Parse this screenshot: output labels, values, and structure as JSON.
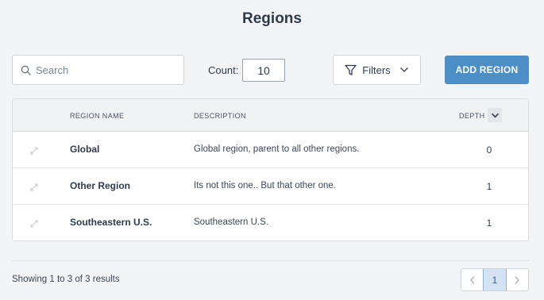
{
  "page": {
    "title": "Regions"
  },
  "toolbar": {
    "search_placeholder": "Search",
    "search_value": "",
    "count_label": "Count:",
    "count_value": "10",
    "filters_label": "Filters",
    "add_label": "ADD REGION"
  },
  "table": {
    "columns": [
      "REGION NAME",
      "DESCRIPTION",
      "DEPTH"
    ],
    "rows": [
      {
        "name": "Global",
        "description": "Global region, parent to all other regions.",
        "depth": "0"
      },
      {
        "name": "Other Region",
        "description": "Its not this one.. But that other one.",
        "depth": "1"
      },
      {
        "name": "Southeastern U.S.",
        "description": "Southeastern U.S.",
        "depth": "1"
      }
    ]
  },
  "footer": {
    "showing_prefix": "Showing",
    "showing_from": "1",
    "showing_to_word": "to",
    "showing_to": "3",
    "showing_of_word": "of",
    "showing_total": "3",
    "showing_suffix": "results",
    "current_page": "1"
  },
  "colors": {
    "accent": "#4b8fc6",
    "page_bg": "#f3f4f6",
    "pager_active": "#d3e3f3"
  },
  "icons": {
    "search": "search-icon",
    "filter": "filter-icon",
    "chevron": "chevron-down-icon",
    "expand": "expand-icon",
    "prev": "chevron-left-icon",
    "next": "chevron-right-icon"
  }
}
